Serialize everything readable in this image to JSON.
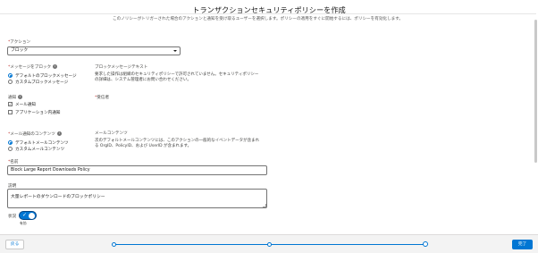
{
  "header": {
    "title": "トランザクションセキュリティポリシーを作成",
    "truncated_text": "このノリシーがトリガーされた場合のアクションと通知を受け取るユーザーを選択します。ポリシーの適用をすぐに開始するには、ポリシーを有効化します。"
  },
  "action": {
    "label": "アクション",
    "value": "ブロック"
  },
  "block_message": {
    "label": "メッセージをブロック",
    "options": [
      "デフォルトのブロックメッセージ",
      "カスタムブロックメッセージ"
    ],
    "selected": 0,
    "text_label": "ブロックメッセージテキスト",
    "text_lines": [
      "要求した操作は組織のセキュリティポリシーで許可されていません。セキュリティポリシー",
      "の詳細は、システム管理者にお問い合わせください。"
    ]
  },
  "notification": {
    "label": "通知",
    "options": [
      "メール通知",
      "アプリケーション内通知"
    ],
    "checked": [
      true,
      false
    ],
    "recipient_label": "受信者"
  },
  "email_content": {
    "label": "メール通知のコンテンツ",
    "options": [
      "デフォルトメールコンテンツ",
      "カスタムメールコンテンツ"
    ],
    "selected": 0,
    "text_label": "メールコンテンツ",
    "text_lines": [
      "次のデフォルトメールコンテンツには、このアクションの一般的なイベントデータが含まれ",
      "る OrgID、PolicyID、および UserID が含まれます。"
    ]
  },
  "name": {
    "label": "名前",
    "value": "Block Large Report Downloads Policy"
  },
  "description": {
    "label": "説明",
    "value": "大量レポートのダウンロードのブロックポリシー"
  },
  "status": {
    "label": "状況",
    "sublabel": "有効",
    "enabled": true
  },
  "footer": {
    "back_label": "戻る",
    "done_label": "完了",
    "progress_steps": 3,
    "current_step": 3
  },
  "colors": {
    "brand": "#0176d3",
    "required": "#c23934"
  }
}
